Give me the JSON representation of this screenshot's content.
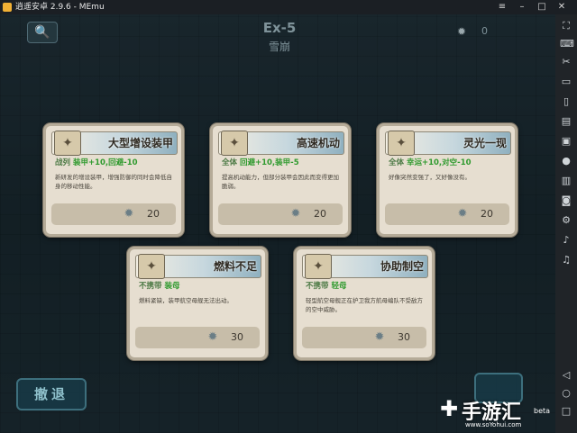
{
  "window": {
    "title": "逍遥安卓 2.9.6 - MEmu",
    "controls": [
      "≡",
      "–",
      "□",
      "✕"
    ]
  },
  "toolbar": {
    "icons": [
      "fullscreen-icon",
      "keyboard-icon",
      "scissors-icon",
      "screen-icon",
      "phone-icon",
      "toolbox-icon",
      "folder-icon",
      "record-icon",
      "shake-icon",
      "camera-icon",
      "settings-icon",
      "volume-up-icon",
      "volume-down-icon",
      "back-icon",
      "home-icon",
      "recents-icon"
    ]
  },
  "hud": {
    "search_glyph": "🔍",
    "stage_code": "Ex-5",
    "stage_name": "雪崩",
    "medal_count": "0",
    "retreat_label": "撤退"
  },
  "watermark": {
    "text": "手游汇",
    "beta": "beta",
    "url": "www.soYohui.com"
  },
  "cards": [
    {
      "title": "大型增设装甲",
      "target": "战列",
      "effect": "装甲+10,回避-10",
      "description": "新研发的增设装甲，增强防御的同时会降低自身的移动性能。",
      "cost": "20"
    },
    {
      "title": "高速机动",
      "target": "全体",
      "effect": "回避+10,装甲-5",
      "description": "提高机动能力，但部分装甲会因此而变得更加脆弱。",
      "cost": "20"
    },
    {
      "title": "灵光一现",
      "target": "全体",
      "effect": "幸运+10,对空-10",
      "description": "好像突然变强了，又好像没有。",
      "cost": "20"
    },
    {
      "title": "燃料不足",
      "target": "不携带",
      "effect": "装母",
      "description": "燃料紧缺，装甲航空母舰无法出动。",
      "cost": "30"
    },
    {
      "title": "协助制空",
      "target": "不携带",
      "effect": "轻母",
      "description": "轻型航空母舰正在护卫我方航母编队不受敌方的空中威胁。",
      "cost": "30"
    }
  ]
}
